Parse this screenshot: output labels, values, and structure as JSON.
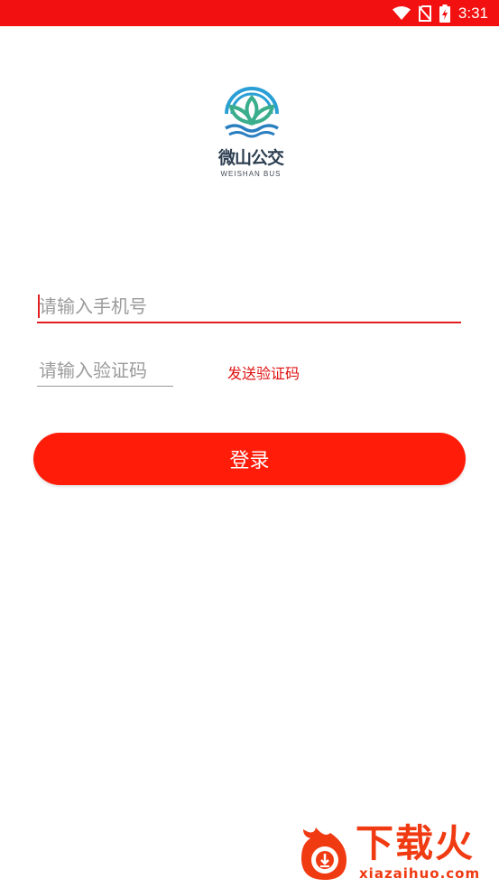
{
  "status_bar": {
    "time": "3:31",
    "background": "#f21010",
    "icons": [
      "wifi-icon",
      "no-sim-icon",
      "battery-charging-icon"
    ]
  },
  "logo": {
    "name": "微山公交",
    "subtitle": "WEISHAN BUS",
    "colors": {
      "arc": "#2a9fd6",
      "leaf": "#3aae8c",
      "wave": "#2a7fc0"
    }
  },
  "login_form": {
    "phone_placeholder": "请输入手机号",
    "code_placeholder": "请输入验证码",
    "send_code_label": "发送验证码",
    "login_label": "登录",
    "accent_color": "#ff1d0a"
  },
  "watermark": {
    "title": "下载火",
    "url": "xiazaihuo.com"
  }
}
